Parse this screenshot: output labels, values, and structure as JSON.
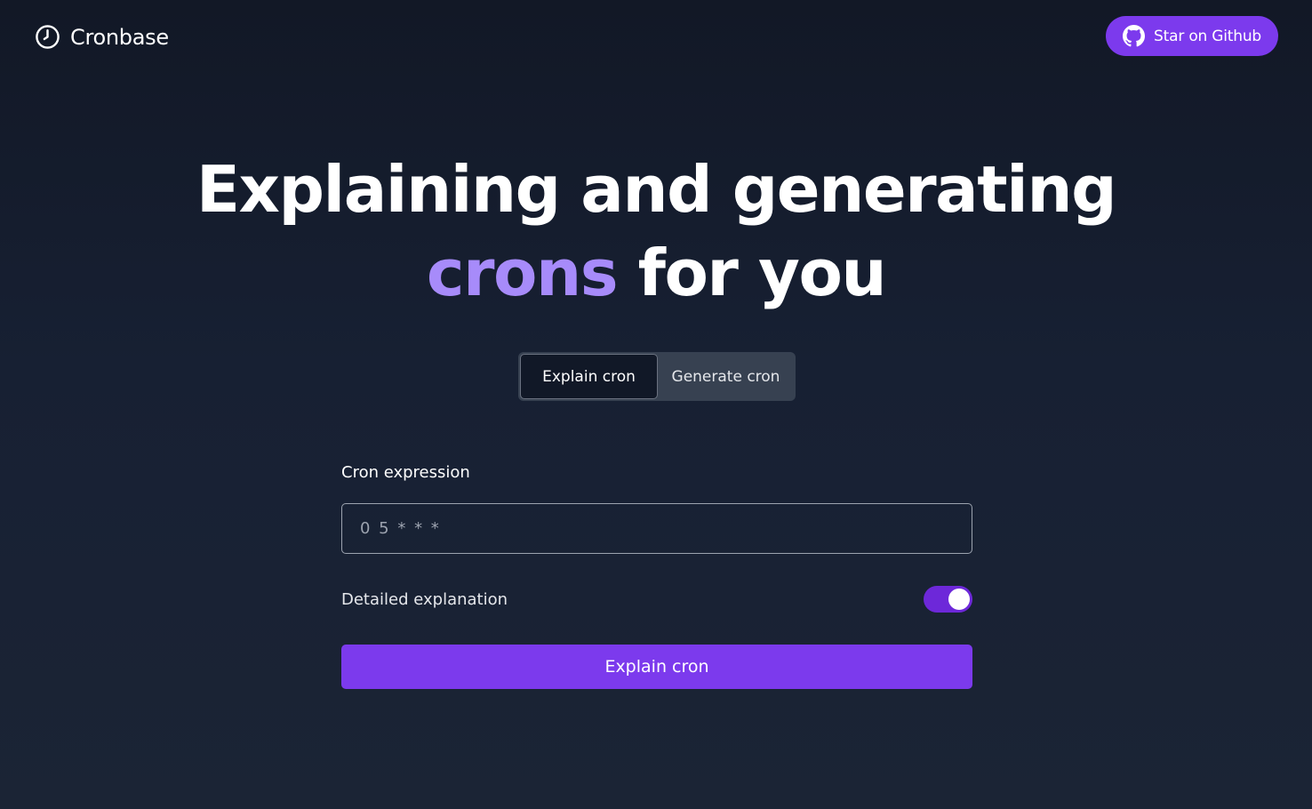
{
  "header": {
    "brand_name": "Cronbase",
    "brand_icon": "clock-icon",
    "github_label": "Star on Github",
    "github_icon": "github-icon"
  },
  "hero": {
    "line1": "Explaining and generating",
    "accent": "crons",
    "line2_rest": " for you"
  },
  "tabs": [
    {
      "label": "Explain cron",
      "active": true
    },
    {
      "label": "Generate cron",
      "active": false
    }
  ],
  "form": {
    "cron_label": "Cron expression",
    "cron_placeholder": "0 5 * * *",
    "cron_value": "",
    "detailed_label": "Detailed explanation",
    "detailed_enabled": true,
    "submit_label": "Explain cron"
  },
  "colors": {
    "accent": "#7c3aed",
    "accent_text": "#a78bfa",
    "background": "#172033"
  }
}
